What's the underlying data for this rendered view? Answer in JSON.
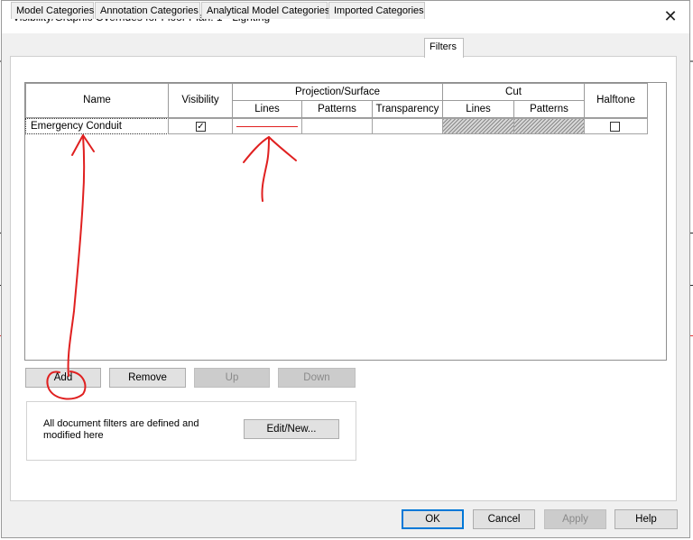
{
  "window": {
    "title": "Visibility/Graphic Overrides for Floor Plan: 1 - Lighting"
  },
  "tabs": [
    {
      "label": "Model Categories"
    },
    {
      "label": "Annotation Categories"
    },
    {
      "label": "Analytical Model Categories"
    },
    {
      "label": "Imported Categories"
    },
    {
      "label": "Filters",
      "active": true
    }
  ],
  "grid": {
    "headers": {
      "name": "Name",
      "visibility": "Visibility",
      "projection_surface": "Projection/Surface",
      "lines": "Lines",
      "patterns": "Patterns",
      "transparency": "Transparency",
      "cut": "Cut",
      "cut_lines": "Lines",
      "cut_patterns": "Patterns",
      "halftone": "Halftone"
    },
    "rows": [
      {
        "name": "Emergency Conduit",
        "visibility": true,
        "lines_color": "#e02020",
        "halftone": false
      }
    ]
  },
  "buttons": {
    "add": "Add",
    "remove": "Remove",
    "up": "Up",
    "down": "Down",
    "edit_new": "Edit/New...",
    "ok": "OK",
    "cancel": "Cancel",
    "apply": "Apply",
    "help": "Help"
  },
  "info": {
    "text": "All document filters are defined and modified here"
  },
  "colors": {
    "annotation": "#e02020",
    "accent": "#0078d7"
  }
}
